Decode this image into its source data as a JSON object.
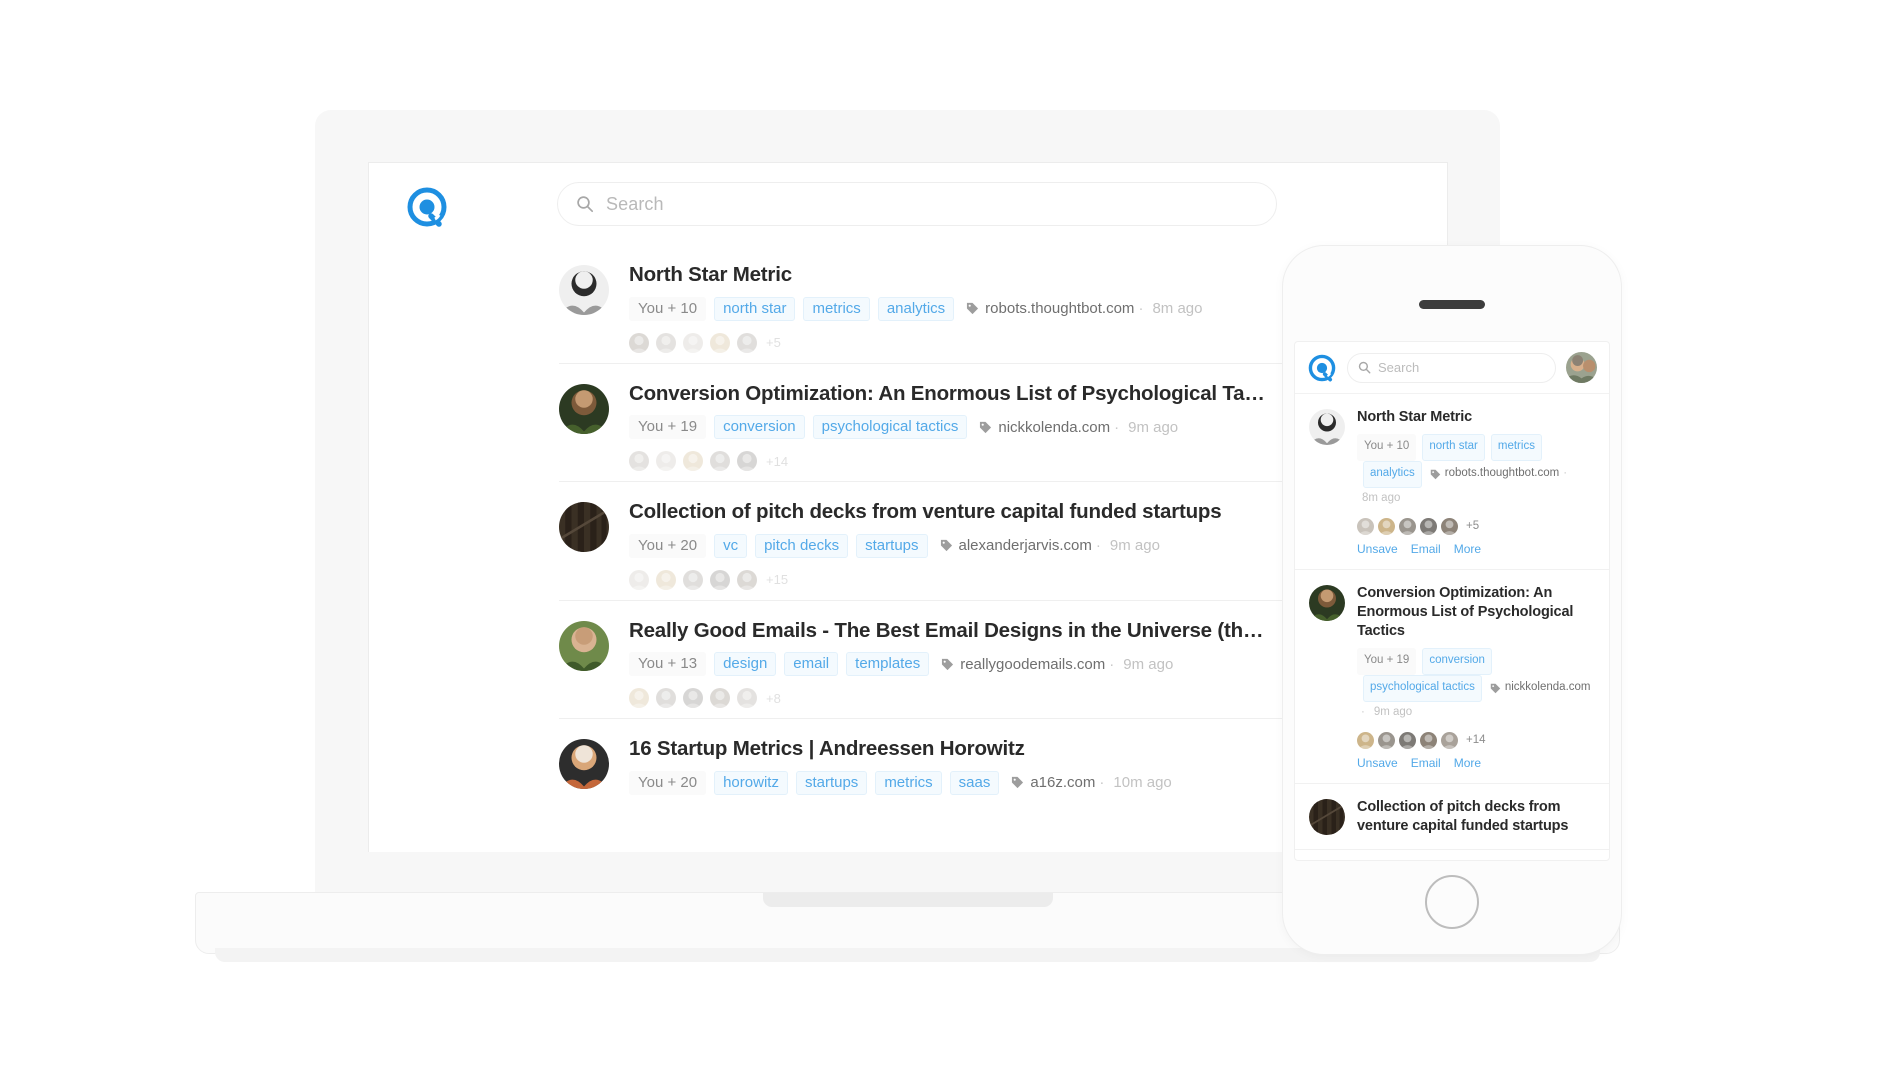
{
  "app": {
    "logo_icon": "quuu-circle-logo-icon",
    "accent_color": "#1e8fe1",
    "tag_color": "#53a9e8"
  },
  "laptop": {
    "header": {
      "logo_icon": "app-logo-icon",
      "search": {
        "icon": "search-icon",
        "placeholder": "Search",
        "value": ""
      }
    },
    "feed": [
      {
        "title": "North Star Metric",
        "you": "You + 10",
        "tags": [
          "north star",
          "metrics",
          "analytics"
        ],
        "tag_icon": "tag-icon",
        "source": "robots.thoughtbot.com",
        "separator": "·",
        "time": "8m ago",
        "avatar_overflow": "+5",
        "avatar_count": 5,
        "avatar_style": "bw-portrait"
      },
      {
        "title": "Conversion Optimization: An Enormous List of Psychological Ta…",
        "you": "You + 19",
        "tags": [
          "conversion",
          "psychological tactics"
        ],
        "tag_icon": "tag-icon",
        "source": "nickkolenda.com",
        "separator": "·",
        "time": "9m ago",
        "avatar_overflow": "+14",
        "avatar_count": 5,
        "avatar_style": "forest-portrait"
      },
      {
        "title": "Collection of pitch decks from venture capital funded startups",
        "you": "You + 20",
        "tags": [
          "vc",
          "pitch decks",
          "startups"
        ],
        "tag_icon": "tag-icon",
        "source": "alexanderjarvis.com",
        "separator": "·",
        "time": "9m ago",
        "avatar_overflow": "+15",
        "avatar_count": 5,
        "avatar_style": "dark-striped"
      },
      {
        "title": "Really Good Emails - The Best Email Designs in the Universe (th…",
        "you": "You + 13",
        "tags": [
          "design",
          "email",
          "templates"
        ],
        "tag_icon": "tag-icon",
        "source": "reallygoodemails.com",
        "separator": "·",
        "time": "9m ago",
        "avatar_overflow": "+8",
        "avatar_count": 5,
        "avatar_style": "green-portrait"
      },
      {
        "title": "16 Startup Metrics | Andreessen Horowitz",
        "you": "You + 20",
        "tags": [
          "horowitz",
          "startups",
          "metrics",
          "saas"
        ],
        "tag_icon": "tag-icon",
        "source": "a16z.com",
        "separator": "·",
        "time": "10m ago",
        "avatar_overflow": "",
        "avatar_count": 0,
        "avatar_style": "orange-portrait"
      }
    ]
  },
  "phone": {
    "header": {
      "logo_icon": "app-logo-icon",
      "search": {
        "icon": "search-icon",
        "placeholder": "Search",
        "value": ""
      },
      "profile_avatar": "user-avatar"
    },
    "feed": [
      {
        "title": "North Star Metric",
        "you": "You + 10",
        "tags": [
          "north star",
          "metrics",
          "analytics"
        ],
        "tag_icon": "tag-icon",
        "source": "robots.thoughtbot.com",
        "separator": "·",
        "time": "8m ago",
        "avatar_overflow": "+5",
        "avatar_count": 5,
        "avatar_style": "bw-portrait",
        "actions": [
          "Unsave",
          "Email",
          "More"
        ]
      },
      {
        "title": "Conversion Optimization: An Enormous List of Psychological Tactics",
        "you": "You + 19",
        "tags": [
          "conversion",
          "psychological tactics"
        ],
        "tag_icon": "tag-icon",
        "source": "nickkolenda.com",
        "separator": "·",
        "time": "9m ago",
        "avatar_overflow": "+14",
        "avatar_count": 5,
        "avatar_style": "forest-portrait",
        "actions": [
          "Unsave",
          "Email",
          "More"
        ]
      },
      {
        "title": "Collection of pitch decks from venture capital funded startups",
        "you": "",
        "tags": [],
        "tag_icon": "",
        "source": "",
        "separator": "",
        "time": "",
        "avatar_overflow": "",
        "avatar_count": 0,
        "avatar_style": "dark-striped",
        "actions": []
      }
    ]
  },
  "phone_chrome": {
    "speaker_icon": "speaker-grille-icon",
    "home_button_icon": "home-button-icon"
  },
  "laptop_chrome": {
    "base_icon": "laptop-base",
    "notch_icon": "trackpad-notch"
  }
}
